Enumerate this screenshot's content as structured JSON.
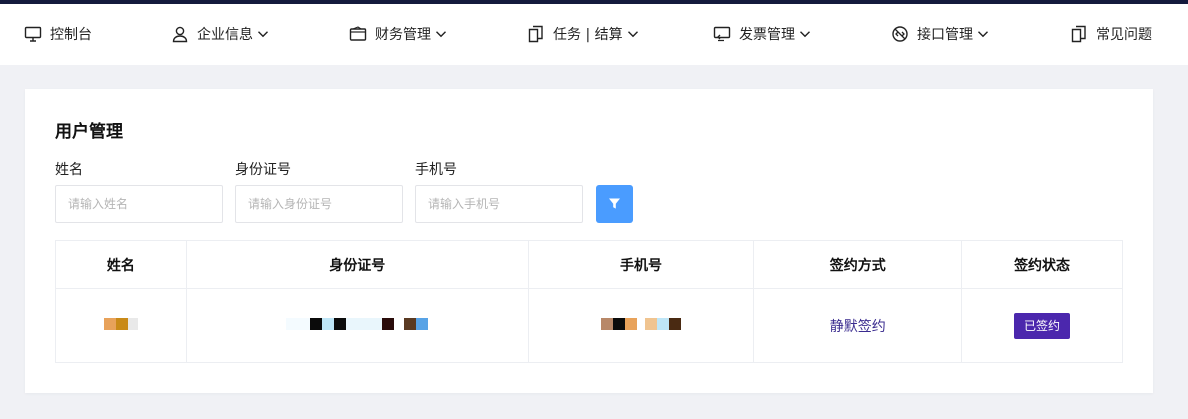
{
  "nav": {
    "items": [
      {
        "label": "控制台",
        "icon": "monitor-icon"
      },
      {
        "label": "企业信息",
        "icon": "user-icon",
        "dropdown": true
      },
      {
        "label": "财务管理",
        "icon": "wallet-icon",
        "dropdown": true
      },
      {
        "label": "任务 | 结算",
        "icon": "document-icon",
        "dropdown": true
      },
      {
        "label": "发票管理",
        "icon": "invoice-icon",
        "dropdown": true
      },
      {
        "label": "接口管理",
        "icon": "api-icon",
        "dropdown": true
      },
      {
        "label": "常见问题",
        "icon": "faq-icon"
      }
    ]
  },
  "page": {
    "title": "用户管理"
  },
  "filters": {
    "name_label": "姓名",
    "name_placeholder": "请输入姓名",
    "id_label": "身份证号",
    "id_placeholder": "请输入身份证号",
    "phone_label": "手机号",
    "phone_placeholder": "请输入手机号"
  },
  "table": {
    "headers": [
      "姓名",
      "身份证号",
      "手机号",
      "签约方式",
      "签约状态"
    ],
    "rows": [
      {
        "sign_method": "静默签约",
        "sign_status": "已签约"
      }
    ]
  },
  "colors": {
    "accent": "#4a9cff",
    "badge": "#4b27ad",
    "link": "#3a2b8f",
    "topbar": "#141a3d"
  }
}
